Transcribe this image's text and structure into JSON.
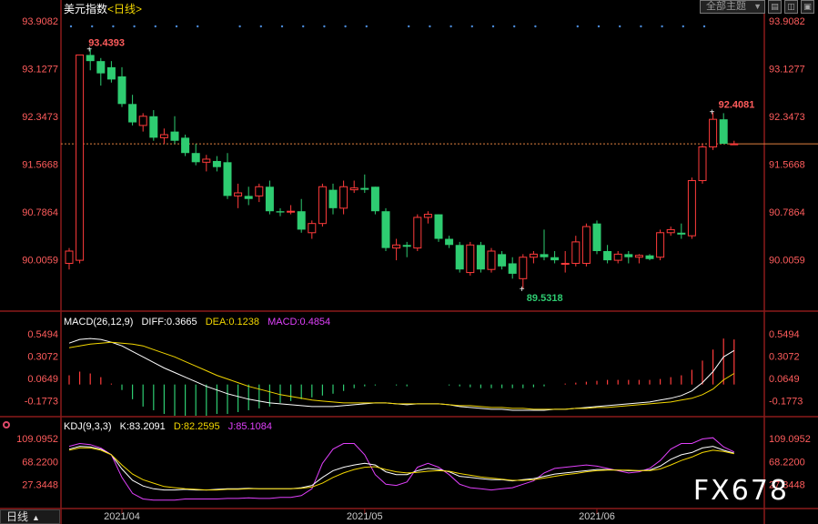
{
  "app": {
    "title": "美元指数",
    "period_label": "<日线>",
    "topic_select": "全部主题",
    "bottom_tab": "日线",
    "watermark": "FX678"
  },
  "colors": {
    "up": "#ff3b3b",
    "down": "#2ecc71",
    "axis_label": "#ff5c5c",
    "grid_dot": "#4a8ad8",
    "diff_line": "#ffffff",
    "dea_line": "#f2d600",
    "j_line": "#e040fb"
  },
  "chart_data": [
    {
      "type": "candlestick",
      "title": "美元指数",
      "y_ticks": [
        "93.9082",
        "93.1277",
        "92.3473",
        "91.5668",
        "90.7864",
        "90.0059"
      ],
      "ylim": [
        89.2,
        93.95
      ],
      "high_label": "93.4393",
      "low_label": "89.5318",
      "latest_high_label": "92.4081",
      "current_price": 91.9,
      "x_labels": [
        "2021/04",
        "2021/05",
        "2021/06"
      ],
      "candles": [
        {
          "o": 89.95,
          "h": 90.2,
          "l": 89.85,
          "c": 90.15
        },
        {
          "o": 90.0,
          "h": 93.0,
          "l": 89.95,
          "c": 93.35
        },
        {
          "o": 93.35,
          "h": 93.44,
          "l": 93.1,
          "c": 93.25
        },
        {
          "o": 93.25,
          "h": 93.3,
          "l": 92.85,
          "c": 93.05
        },
        {
          "o": 93.15,
          "h": 93.25,
          "l": 92.9,
          "c": 92.95
        },
        {
          "o": 93.0,
          "h": 93.15,
          "l": 92.5,
          "c": 92.55
        },
        {
          "o": 92.55,
          "h": 92.7,
          "l": 92.2,
          "c": 92.25
        },
        {
          "o": 92.2,
          "h": 92.4,
          "l": 92.1,
          "c": 92.35
        },
        {
          "o": 92.35,
          "h": 92.45,
          "l": 91.95,
          "c": 92.0
        },
        {
          "o": 92.0,
          "h": 92.15,
          "l": 91.9,
          "c": 92.05
        },
        {
          "o": 92.1,
          "h": 92.35,
          "l": 91.9,
          "c": 91.95
        },
        {
          "o": 92.0,
          "h": 92.05,
          "l": 91.7,
          "c": 91.75
        },
        {
          "o": 91.75,
          "h": 91.9,
          "l": 91.55,
          "c": 91.6
        },
        {
          "o": 91.6,
          "h": 91.72,
          "l": 91.45,
          "c": 91.65
        },
        {
          "o": 91.62,
          "h": 91.7,
          "l": 91.45,
          "c": 91.52
        },
        {
          "o": 91.6,
          "h": 91.75,
          "l": 91.0,
          "c": 91.05
        },
        {
          "o": 91.05,
          "h": 91.25,
          "l": 90.85,
          "c": 91.1
        },
        {
          "o": 91.05,
          "h": 91.2,
          "l": 90.9,
          "c": 91.0
        },
        {
          "o": 91.05,
          "h": 91.25,
          "l": 90.95,
          "c": 91.2
        },
        {
          "o": 91.2,
          "h": 91.3,
          "l": 90.75,
          "c": 90.8
        },
        {
          "o": 90.8,
          "h": 90.85,
          "l": 90.72,
          "c": 90.78
        },
        {
          "o": 90.8,
          "h": 90.9,
          "l": 90.75,
          "c": 90.8
        },
        {
          "o": 90.8,
          "h": 91.0,
          "l": 90.45,
          "c": 90.5
        },
        {
          "o": 90.45,
          "h": 90.65,
          "l": 90.35,
          "c": 90.6
        },
        {
          "o": 90.6,
          "h": 91.25,
          "l": 90.55,
          "c": 91.2
        },
        {
          "o": 91.15,
          "h": 91.25,
          "l": 90.75,
          "c": 90.85
        },
        {
          "o": 90.85,
          "h": 91.3,
          "l": 90.75,
          "c": 91.2
        },
        {
          "o": 91.15,
          "h": 91.3,
          "l": 91.1,
          "c": 91.18
        },
        {
          "o": 91.18,
          "h": 91.4,
          "l": 91.1,
          "c": 91.15
        },
        {
          "o": 91.2,
          "h": 91.2,
          "l": 90.75,
          "c": 90.8
        },
        {
          "o": 90.8,
          "h": 90.85,
          "l": 90.15,
          "c": 90.2
        },
        {
          "o": 90.2,
          "h": 90.35,
          "l": 90.0,
          "c": 90.25
        },
        {
          "o": 90.25,
          "h": 90.3,
          "l": 90.05,
          "c": 90.22
        },
        {
          "o": 90.2,
          "h": 90.75,
          "l": 90.15,
          "c": 90.7
        },
        {
          "o": 90.7,
          "h": 90.8,
          "l": 90.6,
          "c": 90.75
        },
        {
          "o": 90.75,
          "h": 90.75,
          "l": 90.3,
          "c": 90.35
        },
        {
          "o": 90.35,
          "h": 90.4,
          "l": 90.2,
          "c": 90.25
        },
        {
          "o": 90.25,
          "h": 90.3,
          "l": 89.8,
          "c": 89.85
        },
        {
          "o": 89.8,
          "h": 90.3,
          "l": 89.75,
          "c": 90.25
        },
        {
          "o": 90.25,
          "h": 90.3,
          "l": 89.8,
          "c": 89.85
        },
        {
          "o": 89.85,
          "h": 90.2,
          "l": 89.8,
          "c": 90.15
        },
        {
          "o": 90.1,
          "h": 90.15,
          "l": 89.85,
          "c": 89.9
        },
        {
          "o": 89.95,
          "h": 90.05,
          "l": 89.7,
          "c": 89.78
        },
        {
          "o": 89.7,
          "h": 90.1,
          "l": 89.53,
          "c": 90.05
        },
        {
          "o": 90.05,
          "h": 90.15,
          "l": 89.95,
          "c": 90.1
        },
        {
          "o": 90.1,
          "h": 90.5,
          "l": 90.0,
          "c": 90.05
        },
        {
          "o": 90.05,
          "h": 90.15,
          "l": 89.95,
          "c": 90.0
        },
        {
          "o": 89.95,
          "h": 90.15,
          "l": 89.8,
          "c": 89.95
        },
        {
          "o": 89.95,
          "h": 90.4,
          "l": 89.9,
          "c": 90.3
        },
        {
          "o": 89.95,
          "h": 90.6,
          "l": 89.9,
          "c": 90.55
        },
        {
          "o": 90.6,
          "h": 90.65,
          "l": 90.1,
          "c": 90.15
        },
        {
          "o": 90.15,
          "h": 90.25,
          "l": 89.95,
          "c": 90.0
        },
        {
          "o": 90.0,
          "h": 90.15,
          "l": 89.95,
          "c": 90.1
        },
        {
          "o": 90.1,
          "h": 90.15,
          "l": 89.95,
          "c": 90.05
        },
        {
          "o": 90.05,
          "h": 90.1,
          "l": 89.95,
          "c": 90.08
        },
        {
          "o": 90.08,
          "h": 90.1,
          "l": 90.0,
          "c": 90.02
        },
        {
          "o": 90.05,
          "h": 90.5,
          "l": 90.0,
          "c": 90.45
        },
        {
          "o": 90.45,
          "h": 90.55,
          "l": 90.4,
          "c": 90.5
        },
        {
          "o": 90.45,
          "h": 90.6,
          "l": 90.35,
          "c": 90.42
        },
        {
          "o": 90.4,
          "h": 91.35,
          "l": 90.35,
          "c": 91.3
        },
        {
          "o": 91.3,
          "h": 91.9,
          "l": 91.25,
          "c": 91.85
        },
        {
          "o": 91.85,
          "h": 92.41,
          "l": 91.8,
          "c": 92.3
        },
        {
          "o": 92.3,
          "h": 92.4,
          "l": 91.9,
          "c": 91.9
        },
        {
          "o": 91.9,
          "h": 91.95,
          "l": 91.88,
          "c": 91.9
        }
      ]
    },
    {
      "type": "macd",
      "title": "MACD(26,12,9)",
      "params": "(26,12,9)",
      "diff_label": "DIFF:0.3665",
      "dea_label": "DEA:0.1238",
      "macd_label": "MACD:0.4854",
      "y_ticks": [
        "0.5494",
        "0.3072",
        "0.0649",
        "-0.1773"
      ],
      "ylim": [
        -0.32,
        0.62
      ],
      "diff": [
        0.45,
        0.49,
        0.5,
        0.49,
        0.46,
        0.42,
        0.36,
        0.3,
        0.24,
        0.18,
        0.13,
        0.08,
        0.03,
        -0.02,
        -0.06,
        -0.1,
        -0.13,
        -0.16,
        -0.18,
        -0.2,
        -0.21,
        -0.22,
        -0.23,
        -0.24,
        -0.24,
        -0.24,
        -0.23,
        -0.22,
        -0.21,
        -0.2,
        -0.2,
        -0.21,
        -0.22,
        -0.21,
        -0.21,
        -0.21,
        -0.22,
        -0.24,
        -0.25,
        -0.26,
        -0.27,
        -0.27,
        -0.28,
        -0.28,
        -0.28,
        -0.28,
        -0.27,
        -0.27,
        -0.26,
        -0.25,
        -0.24,
        -0.23,
        -0.22,
        -0.21,
        -0.2,
        -0.19,
        -0.17,
        -0.15,
        -0.12,
        -0.07,
        0.02,
        0.14,
        0.3,
        0.37
      ],
      "dea": [
        0.4,
        0.42,
        0.44,
        0.45,
        0.46,
        0.45,
        0.44,
        0.42,
        0.38,
        0.34,
        0.3,
        0.25,
        0.2,
        0.15,
        0.1,
        0.06,
        0.02,
        -0.02,
        -0.05,
        -0.08,
        -0.11,
        -0.13,
        -0.15,
        -0.17,
        -0.18,
        -0.19,
        -0.2,
        -0.2,
        -0.2,
        -0.2,
        -0.2,
        -0.21,
        -0.21,
        -0.21,
        -0.21,
        -0.21,
        -0.22,
        -0.23,
        -0.23,
        -0.24,
        -0.25,
        -0.25,
        -0.26,
        -0.26,
        -0.27,
        -0.27,
        -0.27,
        -0.27,
        -0.26,
        -0.26,
        -0.25,
        -0.25,
        -0.24,
        -0.23,
        -0.22,
        -0.21,
        -0.2,
        -0.19,
        -0.17,
        -0.15,
        -0.11,
        -0.05,
        0.05,
        0.12
      ],
      "macd": [
        0.1,
        0.14,
        0.12,
        0.08,
        0.01,
        -0.06,
        -0.16,
        -0.24,
        -0.28,
        -0.32,
        -0.34,
        -0.34,
        -0.34,
        -0.34,
        -0.32,
        -0.32,
        -0.3,
        -0.28,
        -0.26,
        -0.24,
        -0.2,
        -0.18,
        -0.16,
        -0.14,
        -0.12,
        -0.1,
        -0.07,
        -0.04,
        -0.02,
        -0.01,
        0.0,
        -0.01,
        -0.02,
        0.0,
        0.0,
        0.0,
        -0.01,
        -0.02,
        -0.03,
        -0.04,
        -0.04,
        -0.04,
        -0.04,
        -0.04,
        -0.03,
        -0.02,
        0.0,
        0.01,
        0.02,
        0.03,
        0.04,
        0.05,
        0.05,
        0.05,
        0.05,
        0.05,
        0.06,
        0.08,
        0.1,
        0.16,
        0.26,
        0.38,
        0.5,
        0.49
      ]
    },
    {
      "type": "kdj",
      "title": "KDJ(9,3,3)",
      "params": "(9,3,3)",
      "k_label": "K:83.2091",
      "d_label": "D:82.2595",
      "j_label": "J:85.1084",
      "y_ticks": [
        "109.0952",
        "68.2200",
        "27.3448"
      ],
      "ylim": [
        -10,
        120
      ],
      "k": [
        90,
        95,
        94,
        90,
        80,
        55,
        35,
        25,
        20,
        18,
        18,
        19,
        18,
        18,
        19,
        20,
        20,
        21,
        20,
        20,
        20,
        20,
        22,
        26,
        40,
        52,
        58,
        62,
        65,
        62,
        50,
        45,
        45,
        52,
        56,
        54,
        50,
        42,
        40,
        38,
        36,
        36,
        34,
        36,
        38,
        42,
        46,
        48,
        50,
        52,
        54,
        54,
        53,
        52,
        52,
        53,
        60,
        72,
        80,
        84,
        92,
        95,
        88,
        83
      ],
      "d": [
        88,
        92,
        92,
        88,
        80,
        62,
        46,
        36,
        30,
        24,
        22,
        20,
        19,
        18,
        18,
        19,
        19,
        20,
        20,
        20,
        20,
        20,
        21,
        23,
        30,
        40,
        48,
        54,
        58,
        59,
        54,
        50,
        48,
        49,
        51,
        52,
        51,
        47,
        44,
        41,
        39,
        37,
        35,
        35,
        36,
        39,
        42,
        45,
        47,
        50,
        52,
        53,
        53,
        53,
        52,
        52,
        55,
        62,
        70,
        76,
        84,
        88,
        86,
        82
      ],
      "j": [
        95,
        100,
        98,
        92,
        80,
        40,
        12,
        2,
        0,
        0,
        0,
        2,
        2,
        2,
        2,
        3,
        3,
        4,
        3,
        3,
        5,
        5,
        8,
        20,
        65,
        90,
        100,
        100,
        80,
        45,
        28,
        26,
        32,
        58,
        65,
        58,
        45,
        28,
        22,
        20,
        18,
        20,
        22,
        28,
        34,
        48,
        56,
        58,
        60,
        62,
        60,
        56,
        52,
        48,
        50,
        56,
        70,
        90,
        100,
        100,
        108,
        110,
        94,
        85
      ]
    }
  ]
}
